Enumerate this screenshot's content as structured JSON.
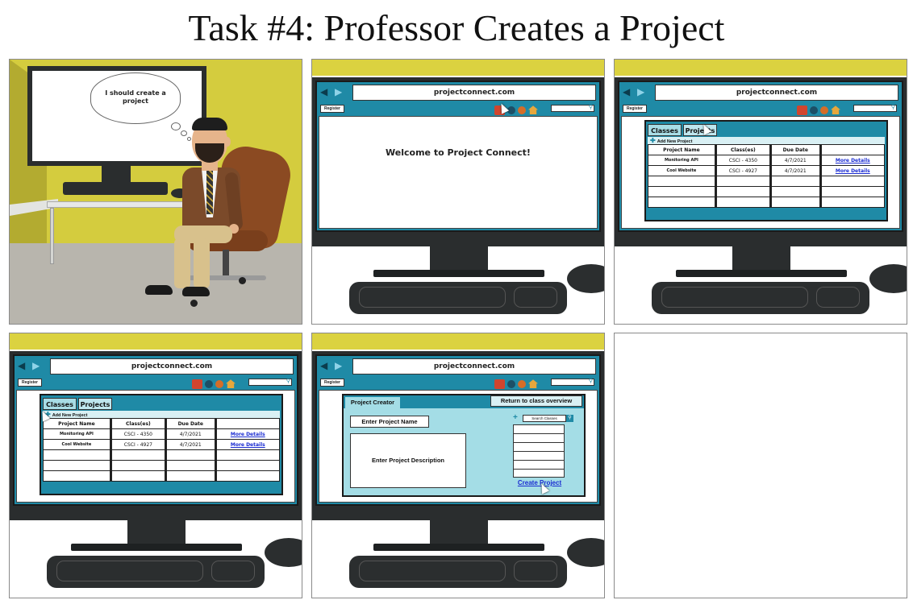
{
  "title": "Task #4: Professor Creates a Project",
  "panel1": {
    "thought": "I should create a project"
  },
  "browser": {
    "url": "projectconnect.com",
    "register": "Register",
    "icons": [
      "back-arrow-icon",
      "forward-arrow-icon",
      "user-icon",
      "info-icon",
      "settings-icon",
      "home-icon",
      "search-icon"
    ],
    "accent_color": "#1f8aa6"
  },
  "panel2": {
    "welcome": "Welcome to Project Connect!"
  },
  "projects_view": {
    "tabs": [
      "Classes",
      "Projects"
    ],
    "add_new": "Add New Project",
    "columns": [
      "Project Name",
      "Class(es)",
      "Due Date",
      ""
    ],
    "rows": [
      [
        "Monitoring API",
        "CSCI - 4350",
        "4/7/2021",
        "More Details"
      ],
      [
        "Cool Website",
        "CSCI - 4927",
        "4/7/2021",
        "More Details"
      ]
    ]
  },
  "creator": {
    "header": "Project Creator",
    "return": "Return to class overview",
    "name_placeholder": "Enter Project Name",
    "desc_placeholder": "Enter Project Description",
    "search_placeholder": "Search Classes",
    "create_button": "Create Project"
  }
}
